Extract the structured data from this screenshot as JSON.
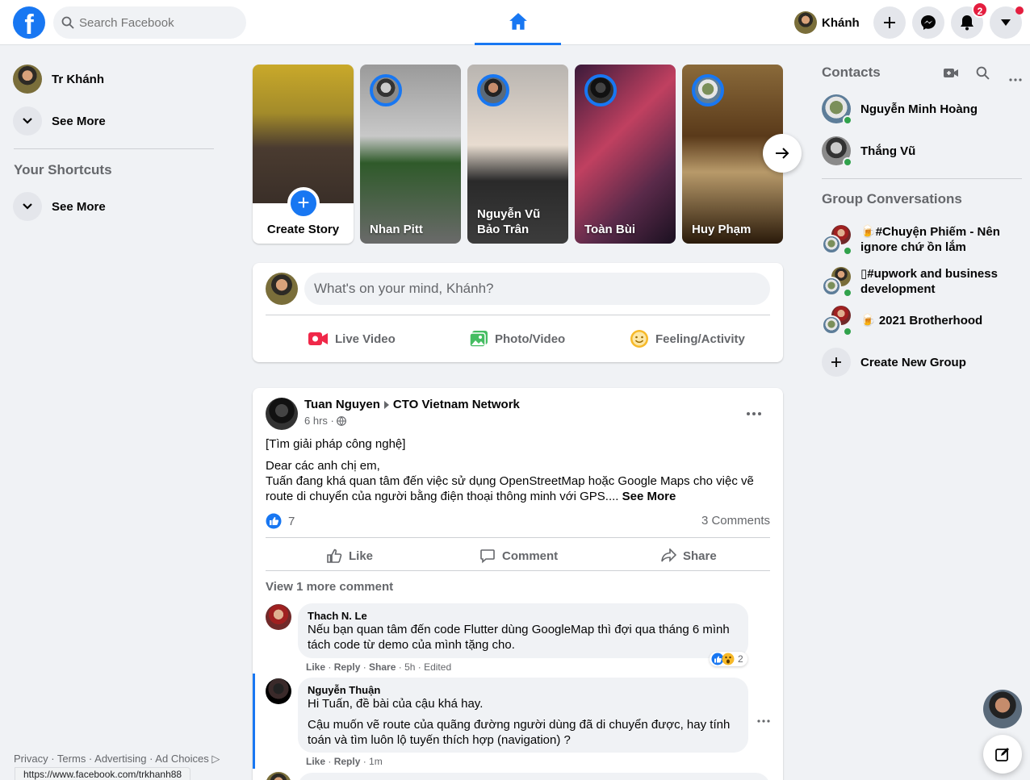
{
  "header": {
    "search_placeholder": "Search Facebook",
    "profile_name": "Khánh",
    "notifications_count": "2"
  },
  "left_sidebar": {
    "profile_name": "Tr Khánh",
    "see_more_1": "See More",
    "shortcuts_title": "Your Shortcuts",
    "see_more_2": "See More",
    "footer": "Privacy · Terms · Advertising · Ad Choices ▷",
    "url_tooltip": "https://www.facebook.com/trkhanh88"
  },
  "stories": {
    "create_label": "Create Story",
    "items": [
      {
        "name": "Nhan Pitt"
      },
      {
        "name": "Nguyễn Vũ Bảo Trân"
      },
      {
        "name": "Toàn Bùi"
      },
      {
        "name": "Huy Phạm"
      }
    ]
  },
  "composer": {
    "placeholder": "What's on your mind, Khánh?",
    "live_video": "Live Video",
    "photo_video": "Photo/Video",
    "feeling": "Feeling/Activity"
  },
  "post": {
    "author": "Tuan Nguyen",
    "group": "CTO Vietnam Network",
    "time": "6 hrs ·",
    "line1": "[Tìm giải pháp công nghệ]",
    "line2": "Dear các anh chị em,",
    "line3": "Tuấn đang khá quan tâm đến việc sử dụng OpenStreetMap hoặc Google Maps cho việc vẽ route di chuyển của người bằng điện thoại thông minh với GPS....",
    "see_more": "See More",
    "reactions_count": "7",
    "comments_count": "3 Comments",
    "like": "Like",
    "comment": "Comment",
    "share": "Share",
    "view_more": "View 1 more comment",
    "comments": [
      {
        "name": "Thach N. Le",
        "text": "Nếu bạn quan tâm đến code Flutter dùng GoogleMap thì đợi qua tháng 6 mình tách code từ demo của mình tặng cho.",
        "like": "Like",
        "reply": "Reply",
        "share": "Share",
        "time": "5h · Edited",
        "reaction_count": "2"
      },
      {
        "name": "Nguyễn Thuận",
        "text1": "Hi Tuấn, đề bài của cậu khá hay.",
        "text2": "Cậu muốn vẽ route của quãng đường người dùng đã di chuyển được, hay tính toán và tìm luôn lộ tuyến thích hợp (navigation) ?",
        "like": "Like",
        "reply": "Reply",
        "time": "1m"
      }
    ]
  },
  "right_sidebar": {
    "contacts_title": "Contacts",
    "contacts": [
      {
        "name": "Nguyễn Minh Hoàng"
      },
      {
        "name": "Thắng Vũ"
      }
    ],
    "groups_title": "Group Conversations",
    "groups": [
      {
        "name": "🍺#Chuyện Phiếm - Nên ignore chứ ồn lắm"
      },
      {
        "name": "▯#upwork and business development"
      },
      {
        "name": "🍺 2021 Brotherhood"
      }
    ],
    "create_group": "Create New Group"
  },
  "colors": {
    "brand": "#1877f2",
    "online": "#31a24c",
    "badge": "#e41e3f"
  }
}
